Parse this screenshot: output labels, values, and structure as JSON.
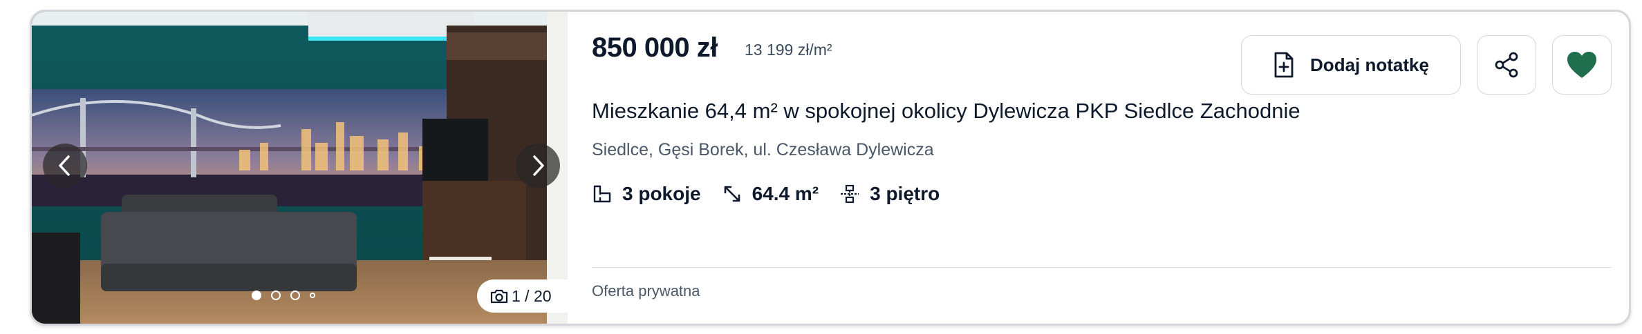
{
  "listing": {
    "price": "850 000 zł",
    "price_per_m2": "13 199 zł/m²",
    "title": "Mieszkanie 64,4 m² w spokojnej okolicy Dylewicza PKP Siedlce Zachodnie",
    "location": "Siedlce, Gęsi Borek, ul. Czesława Dylewicza",
    "features": {
      "rooms": "3 pokoje",
      "area": "64.4 m²",
      "floor": "3 piętro"
    },
    "seller_type": "Oferta prywatna"
  },
  "gallery": {
    "counter": "1 / 20",
    "current_index": 1,
    "total_images": 20,
    "dots_visible": 4
  },
  "actions": {
    "note_label": "Dodaj notatkę",
    "favorite_color": "#1f6f4e"
  },
  "icons": {
    "prev": "chevron-left-icon",
    "next": "chevron-right-icon",
    "camera": "camera-icon",
    "rooms": "floorplan-icon",
    "area": "resize-arrow-icon",
    "floor": "stairs-icon",
    "note": "file-plus-icon",
    "share": "share-icon",
    "favorite": "heart-icon"
  }
}
